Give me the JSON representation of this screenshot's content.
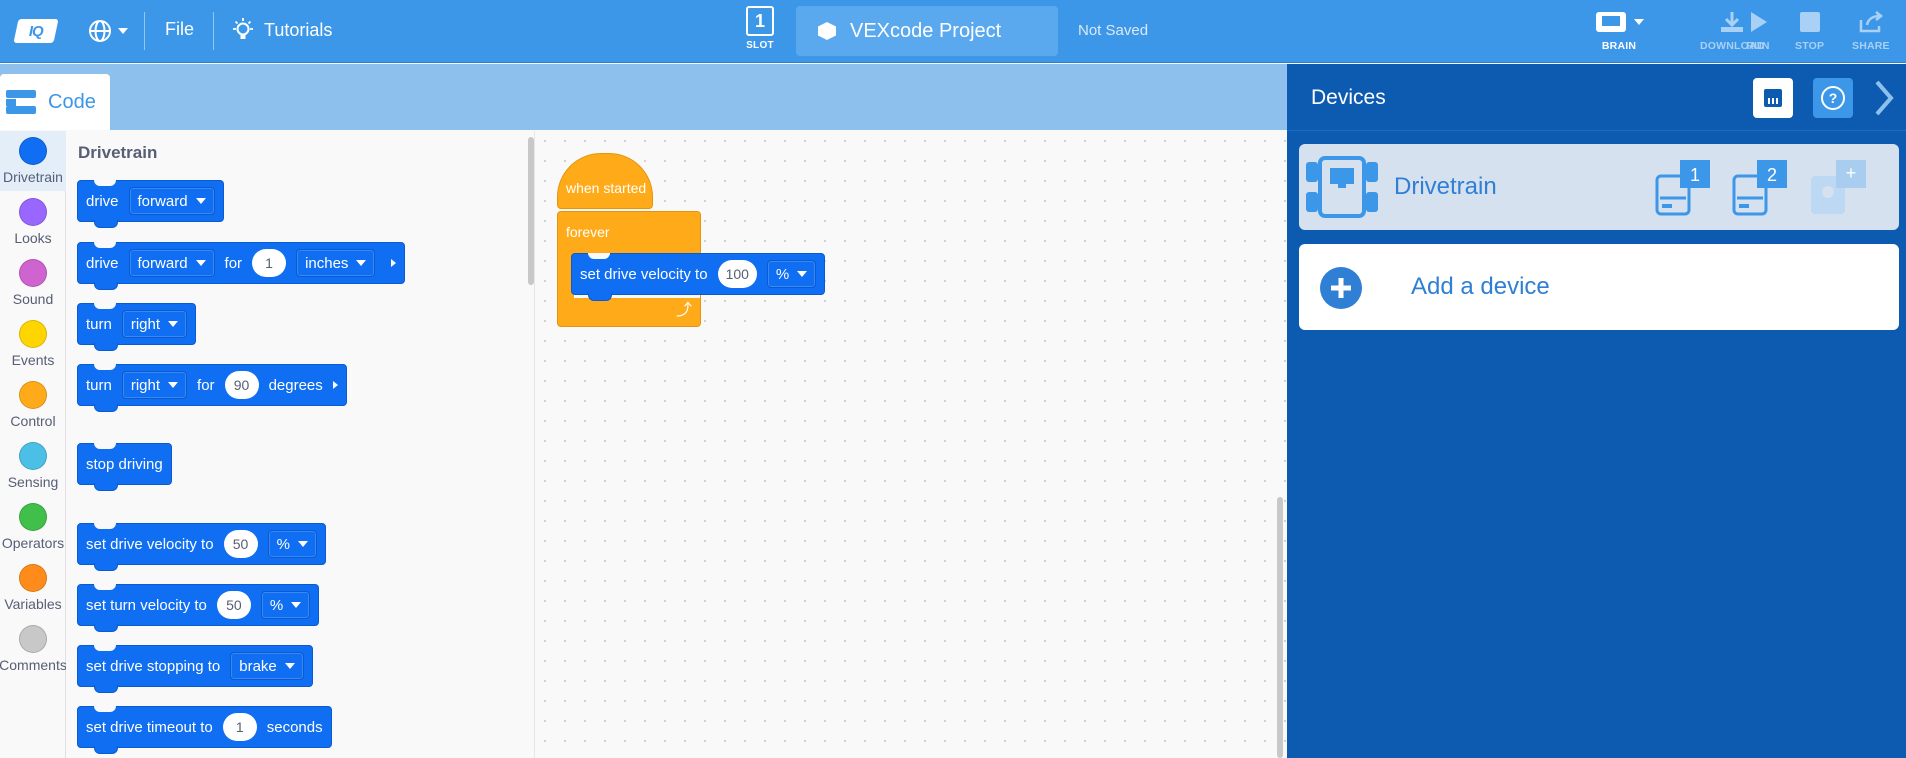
{
  "topbar": {
    "logo": "IQ",
    "file": "File",
    "tutorials": "Tutorials",
    "slot_number": "1",
    "slot_label": "SLOT",
    "project_name": "VEXcode Project",
    "save_status": "Not Saved",
    "brain_label": "BRAIN",
    "download_label": "DOWNLOAD",
    "run_label": "RUN",
    "stop_label": "STOP",
    "share_label": "SHARE"
  },
  "code_tab": {
    "label": "Code"
  },
  "categories": [
    {
      "label": "Drivetrain",
      "color": "#0f6ef2"
    },
    {
      "label": "Looks",
      "color": "#9966ff"
    },
    {
      "label": "Sound",
      "color": "#cf63cf"
    },
    {
      "label": "Events",
      "color": "#ffd500"
    },
    {
      "label": "Control",
      "color": "#ffab19"
    },
    {
      "label": "Sensing",
      "color": "#4cbfe6"
    },
    {
      "label": "Operators",
      "color": "#40bf4a"
    },
    {
      "label": "Variables",
      "color": "#ff8c1a"
    },
    {
      "label": "Comments",
      "color": "#c8c8c8"
    }
  ],
  "palette": {
    "title": "Drivetrain",
    "blocks": {
      "drive": {
        "text": "drive",
        "dir": "forward"
      },
      "drive_for": {
        "text": "drive",
        "dir": "forward",
        "for": "for",
        "amount": "1",
        "unit": "inches"
      },
      "turn": {
        "text": "turn",
        "dir": "right"
      },
      "turn_for": {
        "text": "turn",
        "dir": "right",
        "for": "for",
        "amount": "90",
        "unit": "degrees"
      },
      "stop": {
        "text": "stop driving"
      },
      "drive_velocity": {
        "text": "set drive velocity to",
        "value": "50",
        "unit": "%"
      },
      "turn_velocity": {
        "text": "set turn velocity to",
        "value": "50",
        "unit": "%"
      },
      "stopping": {
        "text": "set drive stopping to",
        "mode": "brake"
      },
      "timeout": {
        "text": "set drive timeout to",
        "value": "1",
        "unit": "seconds"
      }
    }
  },
  "workspace": {
    "hat": "when started",
    "forever": "forever",
    "velocity_text": "set drive velocity to",
    "velocity_value": "100",
    "velocity_unit": "%"
  },
  "devices": {
    "title": "Devices",
    "drivetrain": "Drivetrain",
    "port_1": "1",
    "port_2": "2",
    "port_add": "+",
    "add_device": "Add a device"
  }
}
